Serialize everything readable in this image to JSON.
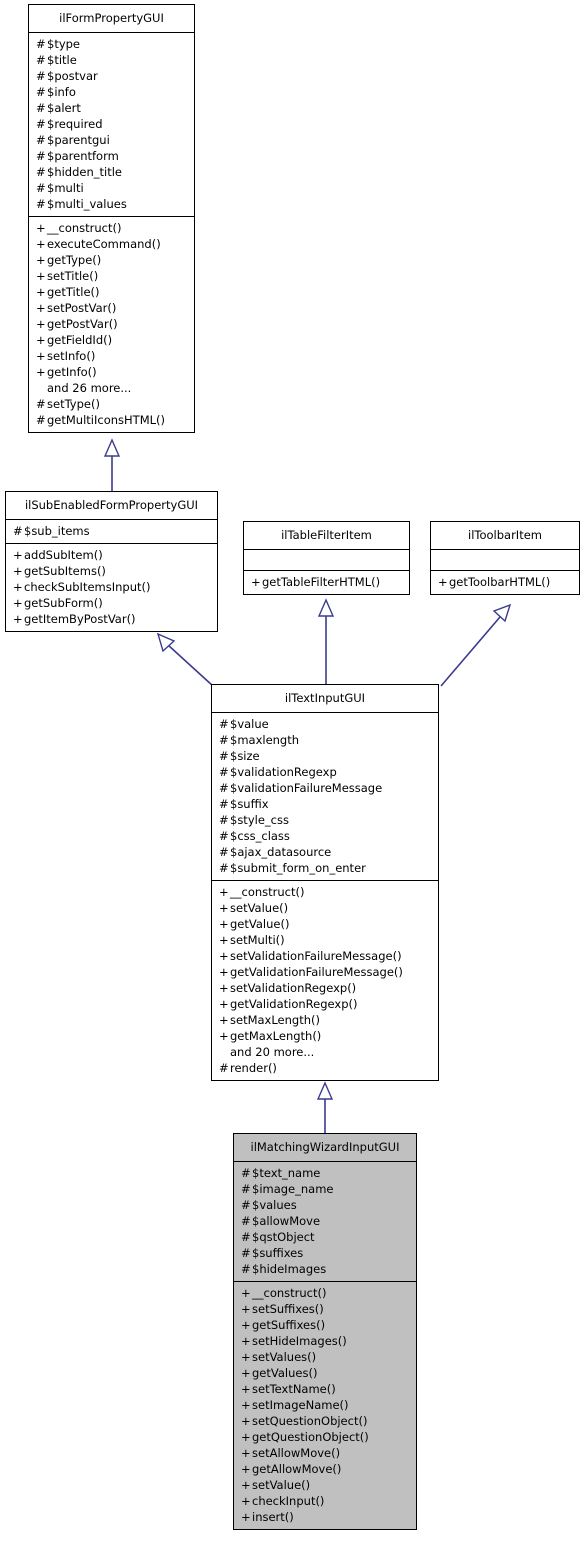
{
  "diagram": {
    "title": "ilMatchingWizardInputGUI inheritance diagram",
    "type": "uml-class-inheritance",
    "edge_color": "#3b3b8f",
    "highlight_fill": "#c0c0c0",
    "box_fill": "#ffffff",
    "border_color": "#000000"
  },
  "classes": {
    "form_property": {
      "name": "ilFormPropertyGUI",
      "attributes": [
        {
          "vis": "#",
          "label": "$type"
        },
        {
          "vis": "#",
          "label": "$title"
        },
        {
          "vis": "#",
          "label": "$postvar"
        },
        {
          "vis": "#",
          "label": "$info"
        },
        {
          "vis": "#",
          "label": "$alert"
        },
        {
          "vis": "#",
          "label": "$required"
        },
        {
          "vis": "#",
          "label": "$parentgui"
        },
        {
          "vis": "#",
          "label": "$parentform"
        },
        {
          "vis": "#",
          "label": "$hidden_title"
        },
        {
          "vis": "#",
          "label": "$multi"
        },
        {
          "vis": "#",
          "label": "$multi_values"
        }
      ],
      "methods": [
        {
          "vis": "+",
          "label": "__construct()"
        },
        {
          "vis": "+",
          "label": "executeCommand()"
        },
        {
          "vis": "+",
          "label": "getType()"
        },
        {
          "vis": "+",
          "label": "setTitle()"
        },
        {
          "vis": "+",
          "label": "getTitle()"
        },
        {
          "vis": "+",
          "label": "setPostVar()"
        },
        {
          "vis": "+",
          "label": "getPostVar()"
        },
        {
          "vis": "+",
          "label": "getFieldId()"
        },
        {
          "vis": "+",
          "label": "setInfo()"
        },
        {
          "vis": "+",
          "label": "getInfo()"
        },
        {
          "vis": "",
          "label": "and 26 more..."
        },
        {
          "vis": "#",
          "label": "setType()"
        },
        {
          "vis": "#",
          "label": "getMultiIconsHTML()"
        }
      ]
    },
    "sub_enabled": {
      "name": "ilSubEnabledFormPropertyGUI",
      "attributes": [
        {
          "vis": "#",
          "label": "$sub_items"
        }
      ],
      "methods": [
        {
          "vis": "+",
          "label": "addSubItem()"
        },
        {
          "vis": "+",
          "label": "getSubItems()"
        },
        {
          "vis": "+",
          "label": "checkSubItemsInput()"
        },
        {
          "vis": "+",
          "label": "getSubForm()"
        },
        {
          "vis": "+",
          "label": "getItemByPostVar()"
        }
      ]
    },
    "table_filter": {
      "name": "ilTableFilterItem",
      "attributes": [],
      "methods": [
        {
          "vis": "+",
          "label": "getTableFilterHTML()"
        }
      ]
    },
    "toolbar_item": {
      "name": "ilToolbarItem",
      "attributes": [],
      "methods": [
        {
          "vis": "+",
          "label": "getToolbarHTML()"
        }
      ]
    },
    "text_input": {
      "name": "ilTextInputGUI",
      "attributes": [
        {
          "vis": "#",
          "label": "$value"
        },
        {
          "vis": "#",
          "label": "$maxlength"
        },
        {
          "vis": "#",
          "label": "$size"
        },
        {
          "vis": "#",
          "label": "$validationRegexp"
        },
        {
          "vis": "#",
          "label": "$validationFailureMessage"
        },
        {
          "vis": "#",
          "label": "$suffix"
        },
        {
          "vis": "#",
          "label": "$style_css"
        },
        {
          "vis": "#",
          "label": "$css_class"
        },
        {
          "vis": "#",
          "label": "$ajax_datasource"
        },
        {
          "vis": "#",
          "label": "$submit_form_on_enter"
        }
      ],
      "methods": [
        {
          "vis": "+",
          "label": "__construct()"
        },
        {
          "vis": "+",
          "label": "setValue()"
        },
        {
          "vis": "+",
          "label": "getValue()"
        },
        {
          "vis": "+",
          "label": "setMulti()"
        },
        {
          "vis": "+",
          "label": "setValidationFailureMessage()"
        },
        {
          "vis": "+",
          "label": "getValidationFailureMessage()"
        },
        {
          "vis": "+",
          "label": "setValidationRegexp()"
        },
        {
          "vis": "+",
          "label": "getValidationRegexp()"
        },
        {
          "vis": "+",
          "label": "setMaxLength()"
        },
        {
          "vis": "+",
          "label": "getMaxLength()"
        },
        {
          "vis": "",
          "label": "and 20 more..."
        },
        {
          "vis": "#",
          "label": "render()"
        }
      ]
    },
    "matching_wizard": {
      "name": "ilMatchingWizardInputGUI",
      "attributes": [
        {
          "vis": "#",
          "label": "$text_name"
        },
        {
          "vis": "#",
          "label": "$image_name"
        },
        {
          "vis": "#",
          "label": "$values"
        },
        {
          "vis": "#",
          "label": "$allowMove"
        },
        {
          "vis": "#",
          "label": "$qstObject"
        },
        {
          "vis": "#",
          "label": "$suffixes"
        },
        {
          "vis": "#",
          "label": "$hideImages"
        }
      ],
      "methods": [
        {
          "vis": "+",
          "label": "__construct()"
        },
        {
          "vis": "+",
          "label": "setSuffixes()"
        },
        {
          "vis": "+",
          "label": "getSuffixes()"
        },
        {
          "vis": "+",
          "label": "setHideImages()"
        },
        {
          "vis": "+",
          "label": "setValues()"
        },
        {
          "vis": "+",
          "label": "getValues()"
        },
        {
          "vis": "+",
          "label": "setTextName()"
        },
        {
          "vis": "+",
          "label": "setImageName()"
        },
        {
          "vis": "+",
          "label": "setQuestionObject()"
        },
        {
          "vis": "+",
          "label": "getQuestionObject()"
        },
        {
          "vis": "+",
          "label": "setAllowMove()"
        },
        {
          "vis": "+",
          "label": "getAllowMove()"
        },
        {
          "vis": "+",
          "label": "setValue()"
        },
        {
          "vis": "+",
          "label": "checkInput()"
        },
        {
          "vis": "+",
          "label": "insert()"
        }
      ]
    }
  },
  "relations": [
    {
      "from": "ilSubEnabledFormPropertyGUI",
      "to": "ilFormPropertyGUI",
      "kind": "generalization"
    },
    {
      "from": "ilTextInputGUI",
      "to": "ilSubEnabledFormPropertyGUI",
      "kind": "generalization"
    },
    {
      "from": "ilTextInputGUI",
      "to": "ilTableFilterItem",
      "kind": "generalization"
    },
    {
      "from": "ilTextInputGUI",
      "to": "ilToolbarItem",
      "kind": "generalization"
    },
    {
      "from": "ilMatchingWizardInputGUI",
      "to": "ilTextInputGUI",
      "kind": "generalization"
    }
  ]
}
